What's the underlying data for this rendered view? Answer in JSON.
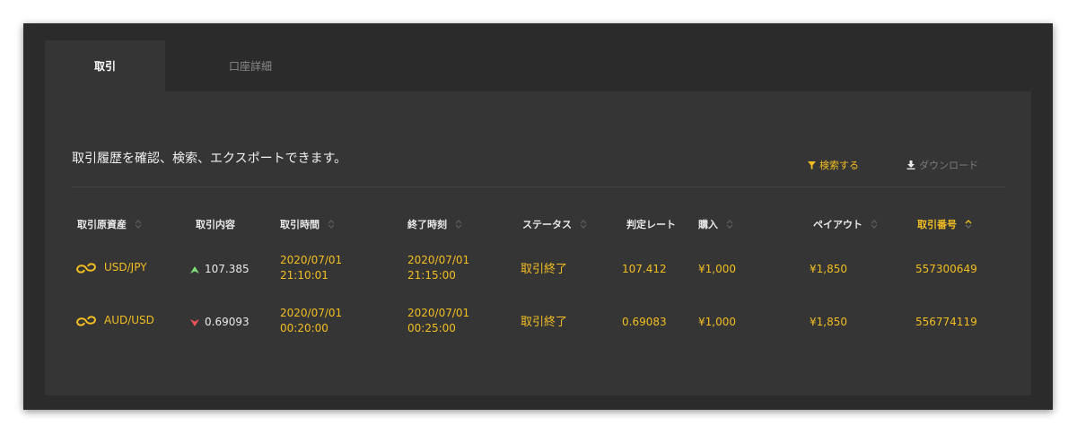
{
  "tabs": [
    {
      "label": "取引"
    },
    {
      "label": "口座詳細"
    }
  ],
  "intro": "取引履歴を確認、検索、エクスポートできます。",
  "actions": {
    "search_label": "検索する",
    "download_label": "ダウンロード"
  },
  "columns": [
    {
      "label": "取引原資産"
    },
    {
      "label": "取引内容"
    },
    {
      "label": "取引時間"
    },
    {
      "label": "終了時刻"
    },
    {
      "label": "ステータス"
    },
    {
      "label": "判定レート"
    },
    {
      "label": "購入"
    },
    {
      "label": "ペイアウト"
    },
    {
      "label": "取引番号"
    }
  ],
  "rows": [
    {
      "asset": "USD/JPY",
      "direction": "up",
      "entry_rate": "107.385",
      "trade_date": "2020/07/01",
      "trade_time": "21:10:01",
      "end_date": "2020/07/01",
      "end_time": "21:15:00",
      "status": "取引終了",
      "judge_rate": "107.412",
      "purchase": "¥1,000",
      "payout": "¥1,850",
      "trade_no": "557300649"
    },
    {
      "asset": "AUD/USD",
      "direction": "down",
      "entry_rate": "0.69093",
      "trade_date": "2020/07/01",
      "trade_time": "00:20:00",
      "end_date": "2020/07/01",
      "end_time": "00:25:00",
      "status": "取引終了",
      "judge_rate": "0.69083",
      "purchase": "¥1,000",
      "payout": "¥1,850",
      "trade_no": "556774119"
    }
  ],
  "colors": {
    "accent": "#f2be22",
    "up": "#7fe07a",
    "down": "#f0545a",
    "panel": "#2b2b2b",
    "content": "#353535"
  },
  "icons": {
    "asset": "exchange-loop-icon",
    "search": "funnel-icon",
    "download": "download-icon",
    "sort": "sort-chevrons-icon"
  }
}
